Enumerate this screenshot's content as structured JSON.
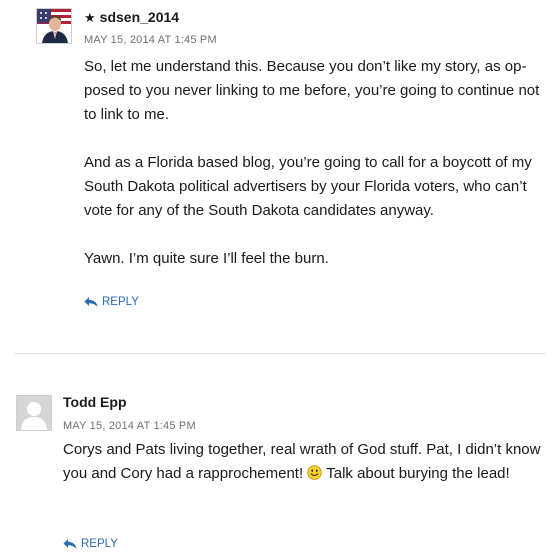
{
  "comments": [
    {
      "author": "sdsen_2014",
      "author_prefix": "★",
      "date": "MAY 15, 2014 AT 1:45 PM",
      "paragraphs": [
        "So, let me understand this. Because you don’t like my story, as op-posed to you never linking to me before, you’re going to continue not to link to me.",
        "And as a Florida based blog, you’re going to call for a boycott of my South Dakota political advertisers by your Florida voters, who can’t vote for any of the South Dakota candidates anyway.",
        "Yawn. I’m quite sure I’ll feel the burn."
      ],
      "reply_label": "REPLY",
      "avatar_icon": "flag-portrait-avatar"
    },
    {
      "author": "Todd Epp",
      "date": "MAY 15, 2014 AT 1:45 PM",
      "text_before_emoji": "Corys and Pats living together, real wrath of God stuff. Pat, I didn’t know you and Cory had a rapprochement! ",
      "text_after_emoji": " Talk about burying the lead!",
      "reply_label": "REPLY",
      "avatar_icon": "default-person-avatar"
    }
  ],
  "colors": {
    "link": "#2b6cb0",
    "meta": "#707070",
    "divider": "#e2e2e2"
  }
}
